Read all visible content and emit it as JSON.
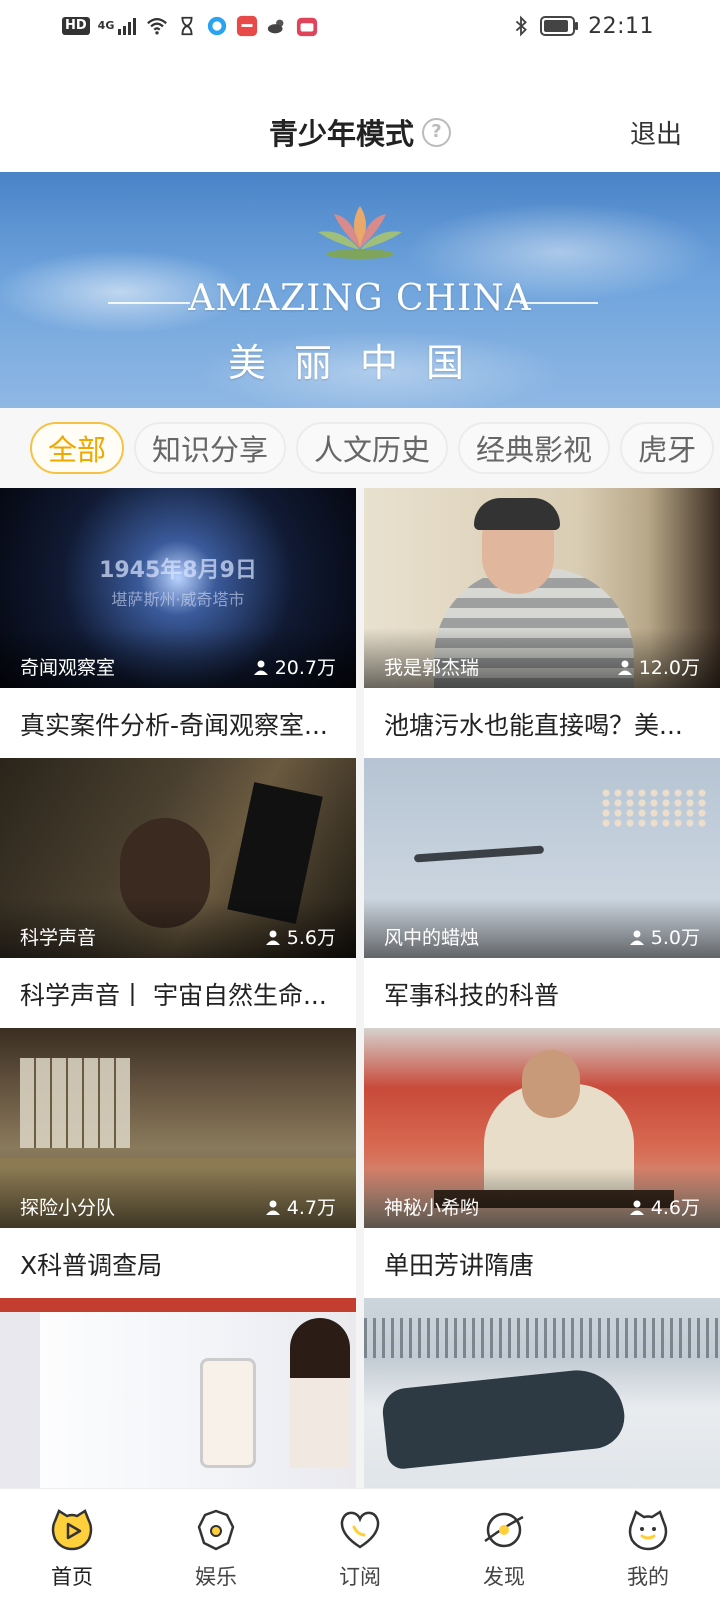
{
  "status_bar": {
    "hd": "HD",
    "signal": "4G",
    "time": "22:11",
    "icons": [
      "hd-icon",
      "signal-icon",
      "wifi-icon",
      "hourglass-icon",
      "browser-icon",
      "app-icon",
      "weather-icon",
      "calendar-icon",
      "bluetooth-icon",
      "battery-icon"
    ]
  },
  "header": {
    "title": "青少年模式",
    "help": "?",
    "exit_label": "退出"
  },
  "banner": {
    "title": "AMAZING CHINA",
    "subtitle": "美丽中国"
  },
  "tabs": [
    {
      "label": "全部",
      "active": true
    },
    {
      "label": "知识分享",
      "active": false
    },
    {
      "label": "人文历史",
      "active": false
    },
    {
      "label": "经典影视",
      "active": false
    },
    {
      "label": "虎牙",
      "active": false
    }
  ],
  "cards": [
    {
      "author": "奇闻观察室",
      "views": "20.7万",
      "title": "真实案件分析-奇闻观察室...",
      "overlay": "1945年8月9日",
      "overlay2": "堪萨斯州·威奇塔市"
    },
    {
      "author": "我是郭杰瑞",
      "views": "12.0万",
      "title": "池塘污水也能直接喝？美..."
    },
    {
      "author": "科学声音",
      "views": "5.6万",
      "title": "科学声音丨 宇宙自然生命..."
    },
    {
      "author": "风中的蜡烛",
      "views": "5.0万",
      "title": "军事科技的科普"
    },
    {
      "author": "探险小分队",
      "views": "4.7万",
      "title": "X科普调查局"
    },
    {
      "author": "神秘小希哟",
      "views": "4.6万",
      "title": "单田芳讲隋唐"
    },
    {
      "author": "",
      "views": "",
      "title": ""
    },
    {
      "author": "",
      "views": "",
      "title": ""
    }
  ],
  "bottom_nav": [
    {
      "label": "首页",
      "icon": "home-icon",
      "active": true
    },
    {
      "label": "娱乐",
      "icon": "entertainment-icon",
      "active": false
    },
    {
      "label": "订阅",
      "icon": "subscribe-icon",
      "active": false
    },
    {
      "label": "发现",
      "icon": "discover-icon",
      "active": false
    },
    {
      "label": "我的",
      "icon": "profile-icon",
      "active": false
    }
  ],
  "colors": {
    "accent": "#f5c244",
    "accent_text": "#f0a800"
  }
}
